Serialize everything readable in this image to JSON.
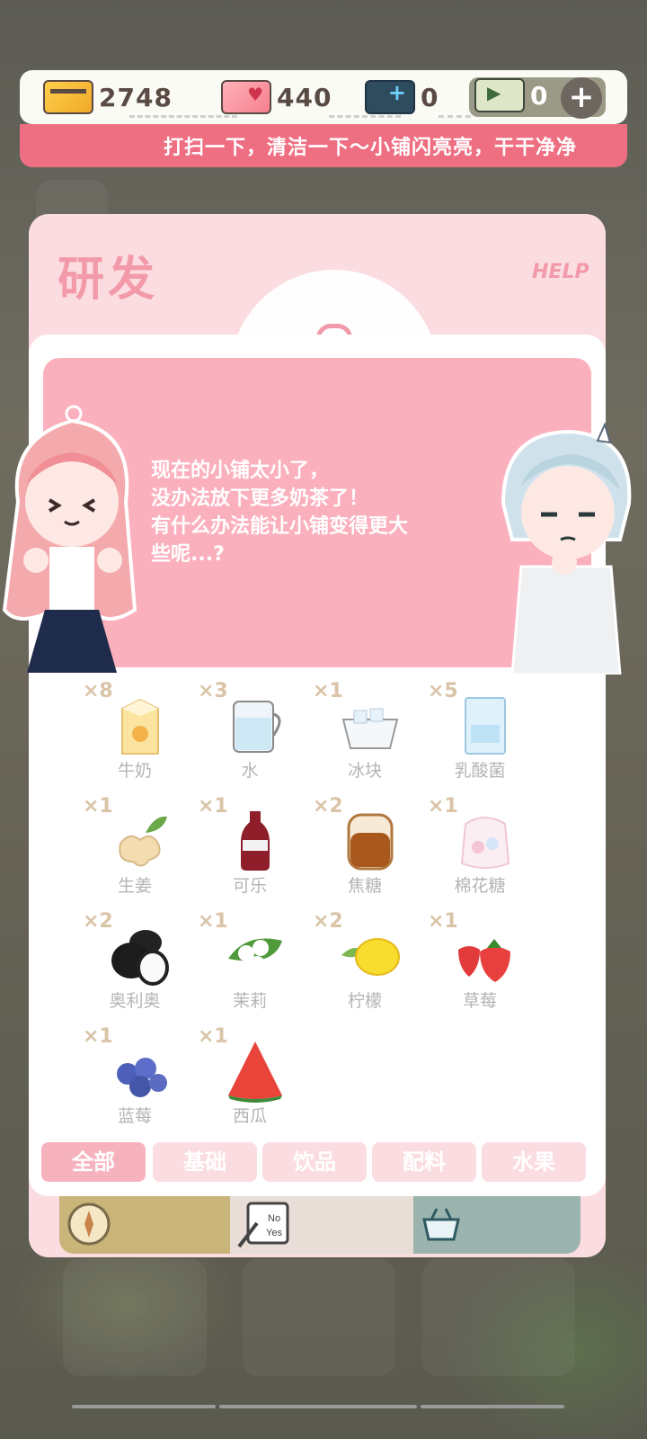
{
  "currencies": [
    {
      "icon": "gold-card-icon",
      "value": "2748"
    },
    {
      "icon": "heart-card-icon",
      "value": "440"
    },
    {
      "icon": "blue-ticket-icon",
      "value": "0"
    },
    {
      "icon": "green-ticket-icon",
      "value": "0"
    }
  ],
  "add_button": "+",
  "marquee": "打扫一下，清洁一下～小铺闪亮亮，干干净净",
  "panel": {
    "title": "研发",
    "help": "HELP"
  },
  "dialog": {
    "lines": [
      "现在的小铺太小了，",
      "没办法放下更多奶茶了！",
      "有什么办法能让小铺变得更大",
      "些呢...?"
    ]
  },
  "items": [
    {
      "name": "牛奶",
      "count": "×8",
      "icon": "milk-carton-icon"
    },
    {
      "name": "水",
      "count": "×3",
      "icon": "water-cup-icon"
    },
    {
      "name": "冰块",
      "count": "×1",
      "icon": "ice-cubes-icon"
    },
    {
      "name": "乳酸菌",
      "count": "×5",
      "icon": "yogurt-box-icon"
    },
    {
      "name": "生姜",
      "count": "×1",
      "icon": "ginger-icon"
    },
    {
      "name": "可乐",
      "count": "×1",
      "icon": "cola-bottle-icon"
    },
    {
      "name": "焦糖",
      "count": "×2",
      "icon": "caramel-jar-icon"
    },
    {
      "name": "棉花糖",
      "count": "×1",
      "icon": "marshmallow-bag-icon"
    },
    {
      "name": "奥利奥",
      "count": "×2",
      "icon": "oreo-icon"
    },
    {
      "name": "茉莉",
      "count": "×1",
      "icon": "jasmine-icon"
    },
    {
      "name": "柠檬",
      "count": "×2",
      "icon": "lemon-icon"
    },
    {
      "name": "草莓",
      "count": "×1",
      "icon": "strawberry-icon"
    },
    {
      "name": "蓝莓",
      "count": "×1",
      "icon": "blueberry-icon"
    },
    {
      "name": "西瓜",
      "count": "×1",
      "icon": "watermelon-icon"
    }
  ],
  "tabs": [
    {
      "label": "全部",
      "active": true
    },
    {
      "label": "基础",
      "active": false
    },
    {
      "label": "饮品",
      "active": false
    },
    {
      "label": "配料",
      "active": false
    },
    {
      "label": "水果",
      "active": false
    }
  ],
  "nav": [
    {
      "icon": "compass-icon"
    },
    {
      "icon": "research-notes-icon"
    },
    {
      "icon": "shopping-basket-icon"
    }
  ],
  "research_notes_labels": {
    "top": "No",
    "bottom": "Yes"
  }
}
